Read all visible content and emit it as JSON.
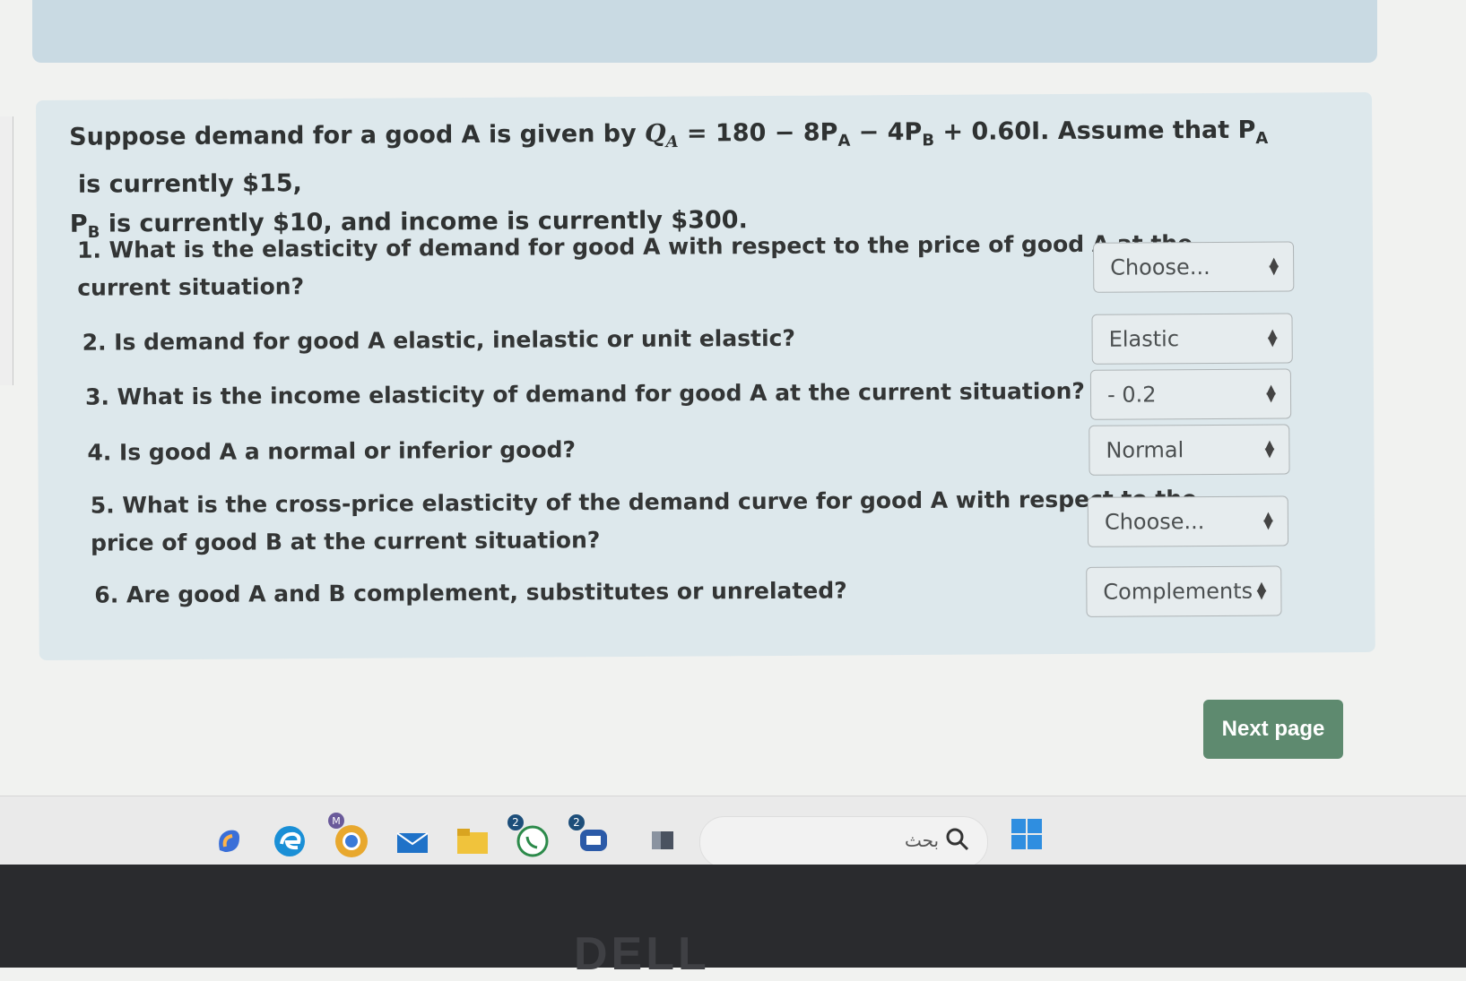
{
  "intro": {
    "line1_a": "Suppose demand for a good A is given by ",
    "formula": "Q",
    "formula_sub": "A",
    "formula_rest": " = 180 − 8P",
    "formula_sub2": "A",
    "formula_rest2": " − 4P",
    "formula_sub3": "B",
    "formula_rest3": " + 0.60I",
    "line1_b": ". Assume that P",
    "pa_sub": "A",
    "line1_c": " is currently $15,",
    "line2_a": "P",
    "pb_sub": "B",
    "line2_b": " is currently $10, and income is currently $300."
  },
  "questions": [
    {
      "text_l1": "1. What is the elasticity of demand for good A with respect to the price of good A at the",
      "text_l2": "current situation?",
      "answer": "Choose..."
    },
    {
      "text_l1": "2. Is demand for good A elastic, inelastic or unit elastic?",
      "answer": "Elastic"
    },
    {
      "text_l1": "3. What is the income elasticity of demand for good A at the current situation?",
      "answer": "- 0.2"
    },
    {
      "text_l1": "4. Is good A a normal or inferior good?",
      "answer": "Normal"
    },
    {
      "text_l1": "5. What is the cross-price elasticity of the demand curve for good A with respect to the",
      "text_l2": "price of good B at the current situation?",
      "answer": "Choose..."
    },
    {
      "text_l1": "6. Are good A and B complement, substitutes or unrelated?",
      "answer": "Complements"
    }
  ],
  "next_button": "Next page",
  "taskbar": {
    "search_text": "بحث",
    "whatsapp_badge": "2",
    "chat_badge": "2",
    "copilot_badge": "M"
  },
  "monitor_brand": "DELL",
  "colors": {
    "card_bg": "#dde8ec",
    "next_button_bg": "#5e8a6f",
    "top_band": "#c9dae3",
    "bezel": "#2a2b2e"
  },
  "icons": [
    "select-arrows-icon",
    "copilot-icon",
    "edge-icon",
    "chrome-icon",
    "mail-icon",
    "file-explorer-icon",
    "whatsapp-icon",
    "chat-icon",
    "app-icon",
    "search-icon",
    "windows-start-icon"
  ]
}
